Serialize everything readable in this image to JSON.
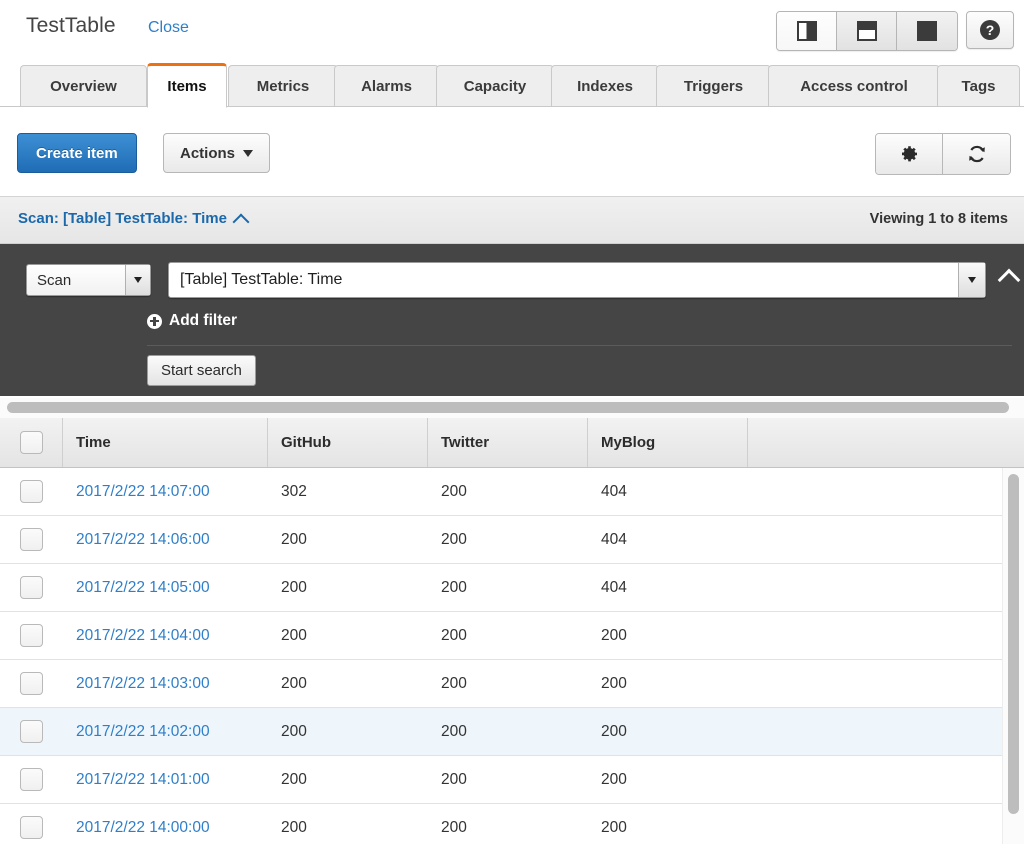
{
  "titlebar": {
    "table_name": "TestTable",
    "close_label": "Close",
    "layout_buttons": [
      {
        "icon": "split-vertical-icon",
        "active": true
      },
      {
        "icon": "split-horizontal-icon",
        "active": false
      },
      {
        "icon": "full-pane-icon",
        "active": false
      }
    ],
    "help_icon": "help-circle-icon"
  },
  "tabs": [
    {
      "label": "Overview",
      "active": false
    },
    {
      "label": "Items",
      "active": true
    },
    {
      "label": "Metrics",
      "active": false
    },
    {
      "label": "Alarms",
      "active": false
    },
    {
      "label": "Capacity",
      "active": false
    },
    {
      "label": "Indexes",
      "active": false
    },
    {
      "label": "Triggers",
      "active": false
    },
    {
      "label": "Access control",
      "active": false
    },
    {
      "label": "Tags",
      "active": false
    }
  ],
  "toolbar": {
    "create_item_label": "Create item",
    "actions_label": "Actions",
    "settings_icon": "gear-icon",
    "refresh_icon": "refresh-icon"
  },
  "scanbar": {
    "title": "Scan: [Table] TestTable: Time",
    "collapse_icon": "chevron-up-icon",
    "viewing_text": "Viewing 1 to 8 items"
  },
  "search_panel": {
    "operation_value": "Scan",
    "target_value": "[Table] TestTable: Time",
    "add_filter_label": "Add filter",
    "add_filter_icon": "plus-circle-icon",
    "start_search_label": "Start search",
    "collapse_icon": "chevron-up-icon"
  },
  "table": {
    "columns": [
      "Time",
      "GitHub",
      "Twitter",
      "MyBlog"
    ],
    "rows": [
      {
        "time": "2017/2/22 14:07:00",
        "github": "302",
        "twitter": "200",
        "myblog": "404",
        "highlighted": false
      },
      {
        "time": "2017/2/22 14:06:00",
        "github": "200",
        "twitter": "200",
        "myblog": "404",
        "highlighted": false
      },
      {
        "time": "2017/2/22 14:05:00",
        "github": "200",
        "twitter": "200",
        "myblog": "404",
        "highlighted": false
      },
      {
        "time": "2017/2/22 14:04:00",
        "github": "200",
        "twitter": "200",
        "myblog": "200",
        "highlighted": false
      },
      {
        "time": "2017/2/22 14:03:00",
        "github": "200",
        "twitter": "200",
        "myblog": "200",
        "highlighted": false
      },
      {
        "time": "2017/2/22 14:02:00",
        "github": "200",
        "twitter": "200",
        "myblog": "200",
        "highlighted": true
      },
      {
        "time": "2017/2/22 14:01:00",
        "github": "200",
        "twitter": "200",
        "myblog": "200",
        "highlighted": false
      },
      {
        "time": "2017/2/22 14:00:00",
        "github": "200",
        "twitter": "200",
        "myblog": "200",
        "highlighted": false
      }
    ]
  },
  "colors": {
    "accent_orange": "#ec7211",
    "link_blue": "#2e7fc9",
    "scan_title_blue": "#1b68ab",
    "primary_button": "#1f6db5",
    "dark_panel": "#454545",
    "row_highlight": "#eef6fc"
  }
}
